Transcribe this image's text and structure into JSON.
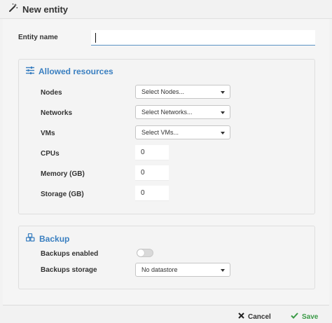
{
  "header": {
    "title": "New entity",
    "icon": "magic-wand-icon"
  },
  "entity_name": {
    "label": "Entity name",
    "value": "",
    "placeholder": ""
  },
  "allowed_resources": {
    "title": "Allowed resources",
    "icon": "sliders-icon",
    "rows": {
      "nodes": {
        "label": "Nodes",
        "selected": "Select Nodes..."
      },
      "networks": {
        "label": "Networks",
        "selected": "Select Networks..."
      },
      "vms": {
        "label": "VMs",
        "selected": "Select VMs..."
      },
      "cpus": {
        "label": "CPUs",
        "value": "0"
      },
      "memory": {
        "label": "Memory (GB)",
        "value": "0"
      },
      "storage": {
        "label": "Storage (GB)",
        "value": "0"
      }
    }
  },
  "backup": {
    "title": "Backup",
    "icon": "cubes-icon",
    "enabled": {
      "label": "Backups enabled",
      "on": false
    },
    "storage": {
      "label": "Backups storage",
      "selected": "No datastore"
    }
  },
  "footer": {
    "cancel_label": "Cancel",
    "save_label": "Save"
  },
  "colors": {
    "accent": "#3a7fc0",
    "save": "#3a9a46",
    "input_underline": "#5b92c4"
  }
}
